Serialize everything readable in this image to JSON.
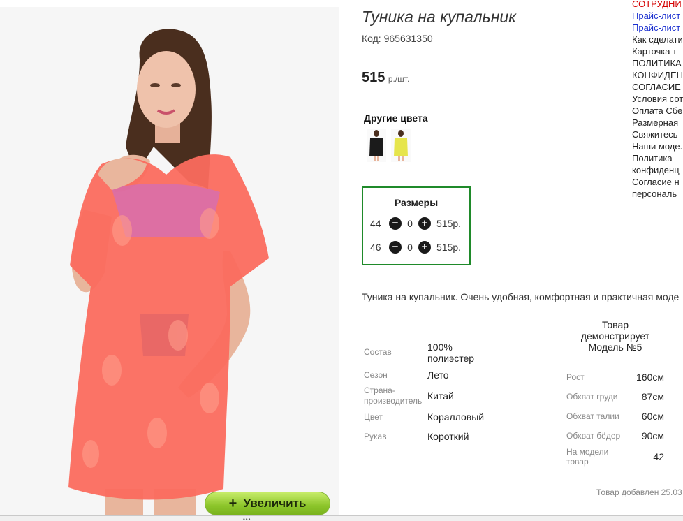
{
  "product": {
    "title": "Туника на купальник",
    "code": "Код: 965631350",
    "price": "515",
    "currency": "р./шт.",
    "zoom_label": "Увеличить",
    "zoom_icon": "plus-icon",
    "description": "Туника на купальник. Очень удобная, комфортная и практичная моде"
  },
  "other_colors": {
    "title": "Другие цвета",
    "swatches": [
      "black",
      "yellow"
    ]
  },
  "sizes": {
    "title": "Размеры",
    "rows": [
      {
        "size": "44",
        "qty": "0",
        "price": "515р."
      },
      {
        "size": "46",
        "qty": "0",
        "price": "515р."
      }
    ]
  },
  "properties": [
    {
      "label": "Состав",
      "value": "100% полиэстер"
    },
    {
      "label": "Сезон",
      "value": "Лето"
    },
    {
      "label": "Страна-производитель",
      "value": "Китай"
    },
    {
      "label": "Цвет",
      "value": "Коралловый"
    },
    {
      "label": "Рукав",
      "value": "Короткий"
    }
  ],
  "model": {
    "title": "Товар демонстрирует Модель №5",
    "measurements": [
      {
        "label": "Рост",
        "value": "160см"
      },
      {
        "label": "Обхват груди",
        "value": "87см"
      },
      {
        "label": "Обхват талии",
        "value": "60см"
      },
      {
        "label": "Обхват бёдер",
        "value": "90см"
      },
      {
        "label": "На модели товар",
        "value": "42"
      }
    ]
  },
  "added": "Товар добавлен 25.03",
  "sidebar": {
    "links": [
      {
        "text": "СОТРУДНИ",
        "color": "#d40000"
      },
      {
        "text": "Прайс-лист",
        "color": "#1a2fd0"
      },
      {
        "text": "Прайс-лист",
        "color": "#1a2fd0"
      },
      {
        "text": "Как сделати",
        "color": "#222222"
      },
      {
        "text": "Карточка т",
        "color": "#222222"
      },
      {
        "text": "ПОЛИТИКА",
        "color": "#222222"
      },
      {
        "text": "КОНФИДЕН",
        "color": "#222222"
      },
      {
        "text": "СОГЛАСИЕ",
        "color": "#222222"
      },
      {
        "text": "Условия сот",
        "color": "#222222"
      },
      {
        "text": "Оплата Сбе",
        "color": "#222222"
      },
      {
        "text": "Размерная",
        "color": "#222222"
      },
      {
        "text": "Свяжитесь",
        "color": "#222222"
      },
      {
        "text": "Наши моде.",
        "color": "#222222"
      },
      {
        "text": "Политика",
        "color": "#222222"
      },
      {
        "text": "конфиденц",
        "color": "#222222"
      },
      {
        "text": "Согласие н",
        "color": "#222222"
      },
      {
        "text": "персональ",
        "color": "#222222"
      }
    ]
  },
  "colors": {
    "accent_green": "#1f8a2a",
    "button_green": "#8cc52a",
    "dress_coral": "#fa6a5a"
  }
}
